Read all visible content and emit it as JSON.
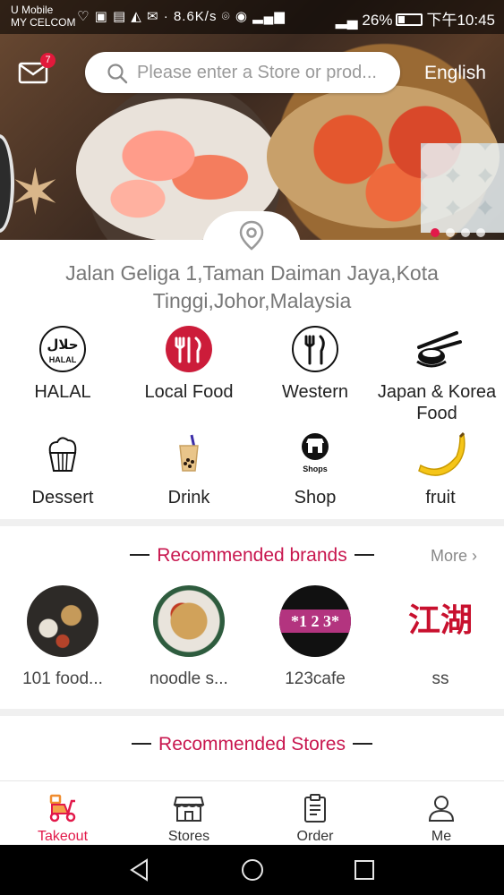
{
  "status_bar": {
    "carrier1": "U Mobile",
    "carrier2": "MY CELCOM",
    "speed": "8.6K/s",
    "battery": "26%",
    "time": "下午10:45"
  },
  "header": {
    "mail_badge": "7",
    "search_placeholder": "Please enter a Store or prod...",
    "language": "English"
  },
  "banner": {
    "slides": 4,
    "active_slide": 1
  },
  "location": {
    "address": "Jalan Geliga 1,Taman Daiman Jaya,Kota Tinggi,Johor,Malaysia"
  },
  "categories": [
    {
      "label": "HALAL",
      "icon": "halal-icon"
    },
    {
      "label": "Local Food",
      "icon": "utensils-icon"
    },
    {
      "label": "Western",
      "icon": "fork-knife-icon"
    },
    {
      "label": "Japan & Korea Food",
      "icon": "sushi-chopsticks-icon"
    },
    {
      "label": "Dessert",
      "icon": "cupcake-icon"
    },
    {
      "label": "Drink",
      "icon": "bubble-tea-icon"
    },
    {
      "label": "Shop",
      "icon": "shop-icon",
      "icon_text": "Shops"
    },
    {
      "label": "fruit",
      "icon": "banana-icon"
    }
  ],
  "brands": {
    "title": "Recommended brands",
    "more": "More",
    "items": [
      {
        "name": "101 food...",
        "logo": "spices-logo"
      },
      {
        "name": "noodle s...",
        "logo": "noodle-bowl-logo"
      },
      {
        "name": "123cafe",
        "logo": "123cafe-logo",
        "logo_text": "*1 2 3*"
      },
      {
        "name": "ss",
        "logo": "calligraphy-logo",
        "logo_text": "江湖"
      }
    ]
  },
  "stores": {
    "title": "Recommended Stores"
  },
  "bottom_nav": [
    {
      "label": "Takeout",
      "icon": "scooter-icon",
      "active": true
    },
    {
      "label": "Stores",
      "icon": "storefront-icon",
      "active": false
    },
    {
      "label": "Order",
      "icon": "clipboard-icon",
      "active": false
    },
    {
      "label": "Me",
      "icon": "person-icon",
      "active": false
    }
  ],
  "colors": {
    "accent": "#e2194a",
    "section_title": "#c8164e",
    "muted_text": "#777777"
  }
}
